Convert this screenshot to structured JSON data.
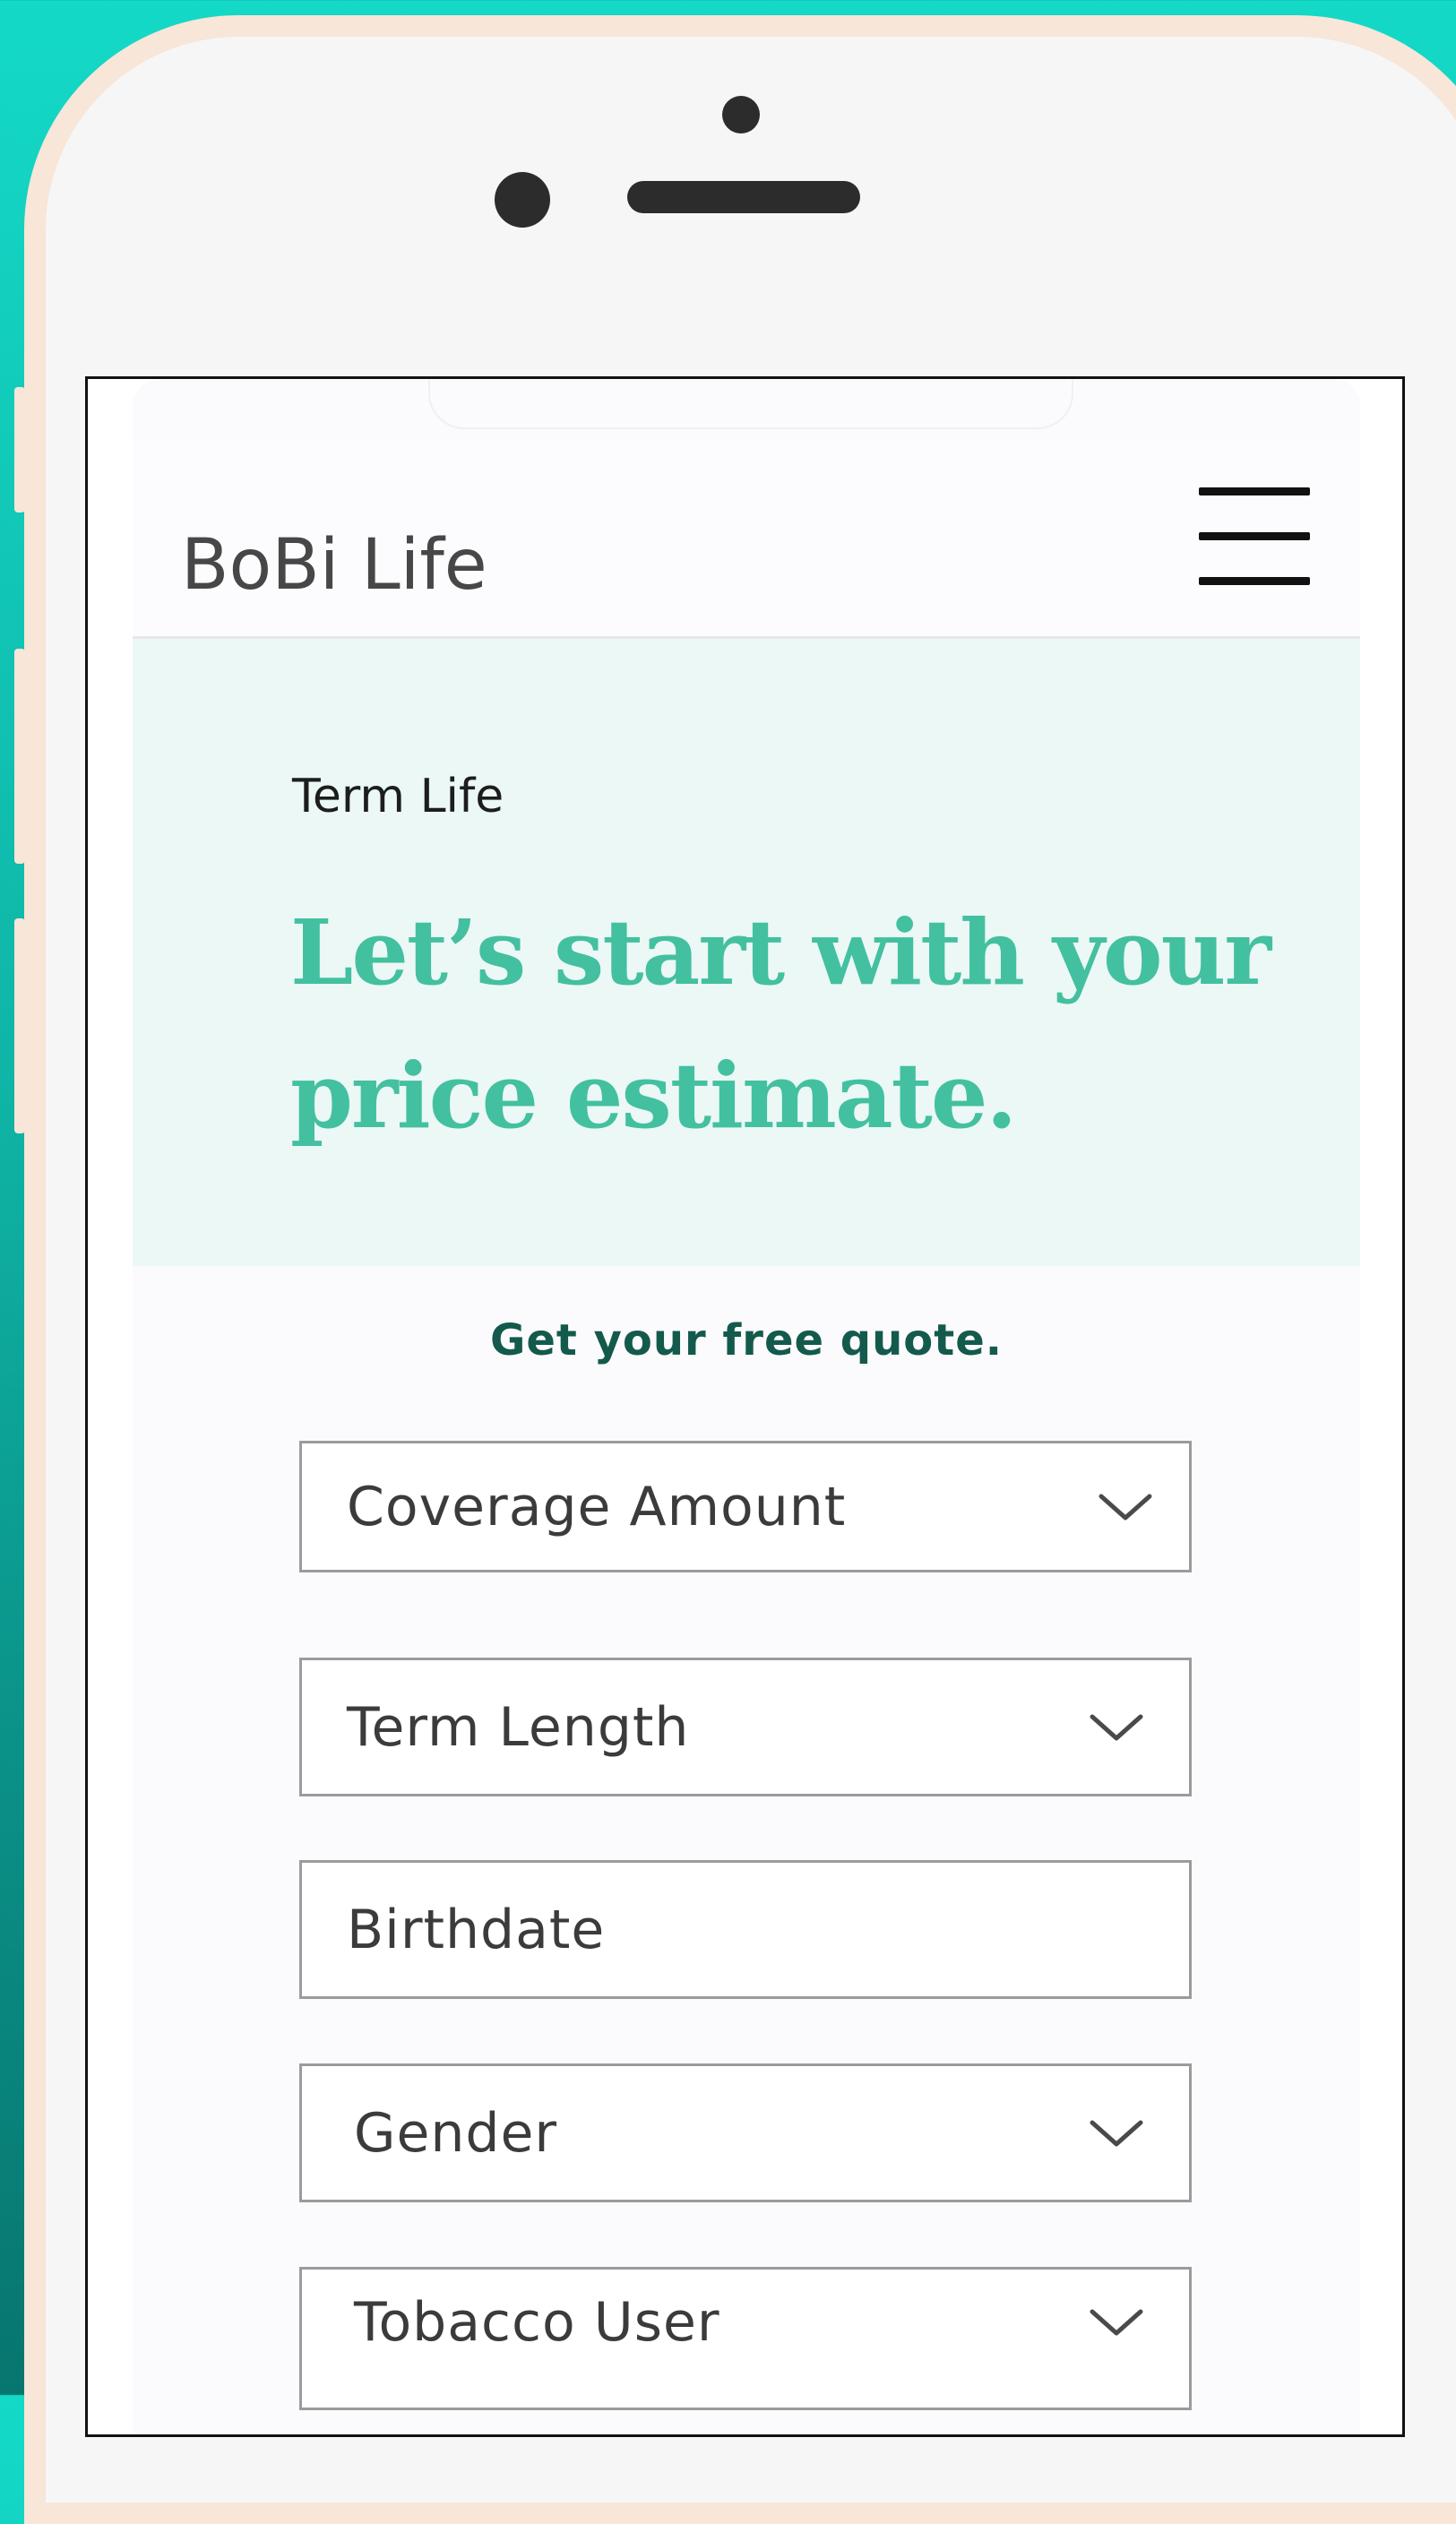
{
  "app": {
    "title": "BoBi Life"
  },
  "hero": {
    "eyebrow": "Term Life",
    "headline": "Let’s start with your price estimate."
  },
  "form": {
    "heading": "Get your free quote.",
    "fields": [
      {
        "label": "Coverage Amount",
        "type": "select"
      },
      {
        "label": "Term Length",
        "type": "select"
      },
      {
        "label": "Birthdate",
        "type": "input"
      },
      {
        "label": "Gender",
        "type": "select"
      },
      {
        "label": "Tobacco User",
        "type": "select"
      }
    ]
  },
  "icons": {
    "menu": "hamburger-menu-icon",
    "dropdown": "chevron-down-icon"
  },
  "colors": {
    "background_teal": "#14d9c7",
    "headline_green": "#43c0a0",
    "hero_background": "#ebf8f5",
    "form_heading": "#135a4c",
    "phone_frame": "#f8e6d8"
  }
}
